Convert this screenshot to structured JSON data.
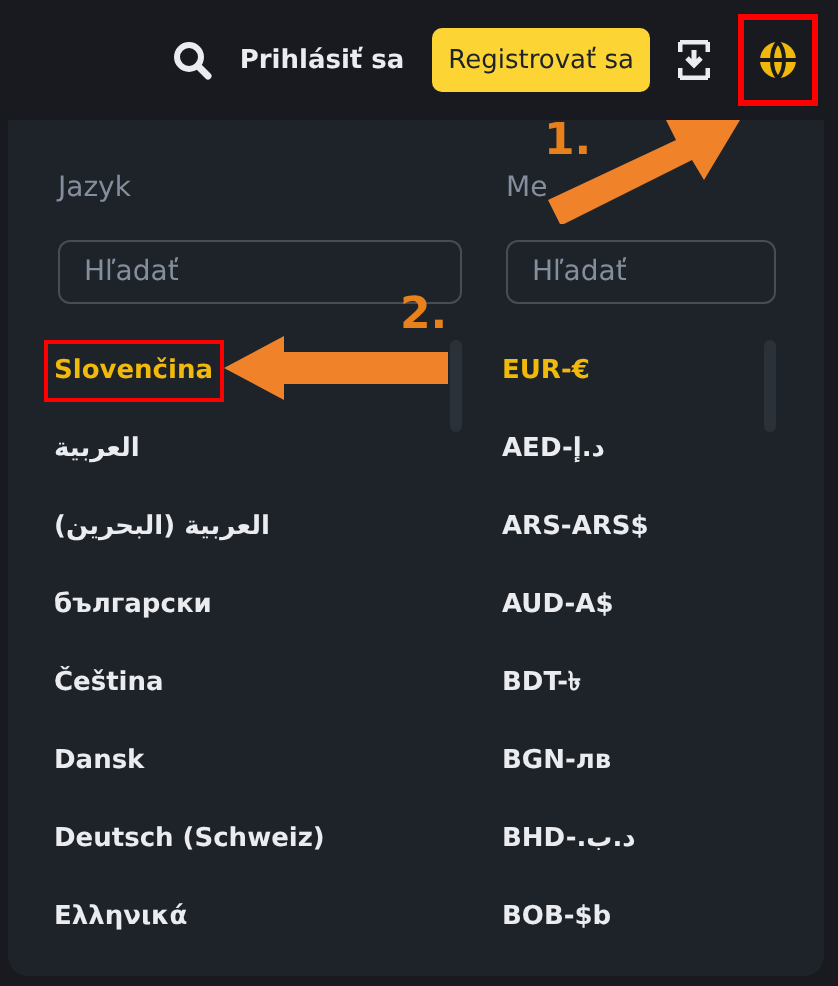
{
  "header": {
    "login": "Prihlásiť sa",
    "register": "Registrovať sa",
    "globe_highlighted": true
  },
  "menu": {
    "language": {
      "title": "Jazyk",
      "placeholder": "Hľadať",
      "items": [
        {
          "label": "Slovenčina",
          "selected": true,
          "highlighted": true
        },
        {
          "label": "العربية",
          "selected": false,
          "highlighted": false
        },
        {
          "label": "العربية (البحرين)",
          "selected": false,
          "highlighted": false
        },
        {
          "label": "български",
          "selected": false,
          "highlighted": false
        },
        {
          "label": "Čeština",
          "selected": false,
          "highlighted": false
        },
        {
          "label": "Dansk",
          "selected": false,
          "highlighted": false
        },
        {
          "label": "Deutsch (Schweiz)",
          "selected": false,
          "highlighted": false
        },
        {
          "label": "Ελληνικά",
          "selected": false,
          "highlighted": false
        }
      ]
    },
    "currency": {
      "title": "Me",
      "placeholder": "Hľadať",
      "items": [
        {
          "label": "EUR-€",
          "selected": true
        },
        {
          "label": "AED-د.إ",
          "selected": false
        },
        {
          "label": "ARS-ARS$",
          "selected": false
        },
        {
          "label": "AUD-A$",
          "selected": false
        },
        {
          "label": "BDT-৳",
          "selected": false
        },
        {
          "label": "BGN-лв",
          "selected": false
        },
        {
          "label": "BHD-.د.ب",
          "selected": false
        },
        {
          "label": "BOB-$b",
          "selected": false
        }
      ]
    }
  },
  "annotations": [
    {
      "label": "1."
    },
    {
      "label": "2."
    }
  ]
}
